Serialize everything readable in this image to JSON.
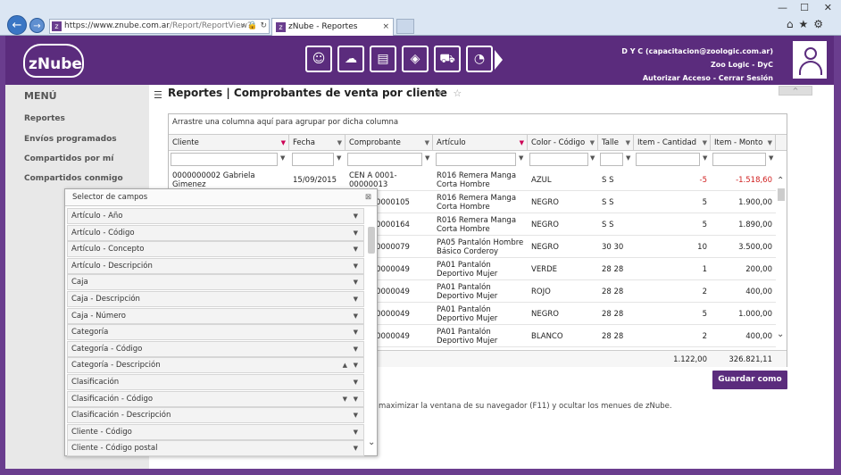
{
  "browser": {
    "url_prefix": "https://",
    "url_domain": "www.znube.com.ar",
    "url_path": "/Report/ReportView?r",
    "tab_title": "zNube - Reportes",
    "tab_favicon": "z"
  },
  "header": {
    "logo": "zNube",
    "user_line1": "D Y C (capacitacion@zoologic.com.ar)",
    "user_line2": "Zoo Logic - DyC",
    "authorize_label": "Autorizar Acceso",
    "separator": " - ",
    "logout_label": "Cerrar Sesión",
    "module_icons": [
      "users-cog-icon",
      "cloud-settings-icon",
      "docs-icon",
      "box-icon",
      "cart-icon",
      "chart-icon"
    ]
  },
  "sidebar": {
    "title": "MENÚ",
    "items": [
      "Reportes",
      "Envíos programados",
      "Compartidos por mí",
      "Compartidos conmigo"
    ]
  },
  "page": {
    "title": "Reportes | Comprobantes de venta por cliente"
  },
  "grid": {
    "group_text": "Arrastre una columna aquí para agrupar por dicha columna",
    "columns": [
      "Cliente",
      "Fecha",
      "Comprobante",
      "Artículo",
      "Color - Código",
      "Talle",
      "Item - Cantidad",
      "Item - Monto"
    ],
    "rows": [
      {
        "cliente": "0000000002 Gabriela Gimenez",
        "fecha": "15/09/2015",
        "comprobante": "CEN A 0001-00000013",
        "articulo": "R016 Remera Manga Corta Hombre",
        "color": "AZUL",
        "talle": "S S",
        "cantidad": "-5",
        "monto": "-1.518,60",
        "neg": true
      },
      {
        "cliente": "",
        "fecha": "",
        "comprobante": "0001-00000105",
        "articulo": "R016 Remera Manga Corta Hombre",
        "color": "NEGRO",
        "talle": "S S",
        "cantidad": "5",
        "monto": "1.900,00",
        "neg": false
      },
      {
        "cliente": "",
        "fecha": "",
        "comprobante": "0001-00000164",
        "articulo": "R016 Remera Manga Corta Hombre",
        "color": "NEGRO",
        "talle": "S S",
        "cantidad": "5",
        "monto": "1.890,00",
        "neg": false
      },
      {
        "cliente": "",
        "fecha": "",
        "comprobante": "0001-00000079",
        "articulo": "PA05 Pantalón Hombre Básico Corderoy",
        "color": "NEGRO",
        "talle": "30 30",
        "cantidad": "10",
        "monto": "3.500,00",
        "neg": false
      },
      {
        "cliente": "",
        "fecha": "",
        "comprobante": "0001-00000049",
        "articulo": "PA01 Pantalón Deportivo Mujer",
        "color": "VERDE",
        "talle": "28 28",
        "cantidad": "1",
        "monto": "200,00",
        "neg": false
      },
      {
        "cliente": "",
        "fecha": "",
        "comprobante": "0001-00000049",
        "articulo": "PA01 Pantalón Deportivo Mujer",
        "color": "ROJO",
        "talle": "28 28",
        "cantidad": "2",
        "monto": "400,00",
        "neg": false
      },
      {
        "cliente": "",
        "fecha": "",
        "comprobante": "0001-00000049",
        "articulo": "PA01 Pantalón Deportivo Mujer",
        "color": "NEGRO",
        "talle": "28 28",
        "cantidad": "5",
        "monto": "1.000,00",
        "neg": false
      },
      {
        "cliente": "",
        "fecha": "",
        "comprobante": "0001-00000049",
        "articulo": "PA01 Pantalón Deportivo Mujer",
        "color": "BLANCO",
        "talle": "28 28",
        "cantidad": "2",
        "monto": "400,00",
        "neg": false
      }
    ],
    "total_cantidad": "1.122,00",
    "total_monto": "326.821,11"
  },
  "actions": {
    "save_as": "Guardar como",
    "hint": "maximizar la ventana de su navegador (F11) y ocultar los menues de zNube."
  },
  "field_selector": {
    "title": "Selector de campos",
    "items": [
      "Artículo - Año",
      "Artículo - Código",
      "Artículo - Concepto",
      "Artículo - Descripción",
      "Caja",
      "Caja - Descripción",
      "Caja - Número",
      "Categoría",
      "Categoría - Código",
      "Categoría - Descripción",
      "Clasificación",
      "Clasificación - Código",
      "Clasificación - Descripción",
      "Cliente - Código",
      "Cliente - Código postal"
    ]
  },
  "colors": {
    "brand": "#5b2c7d",
    "negative": "#d02020"
  }
}
